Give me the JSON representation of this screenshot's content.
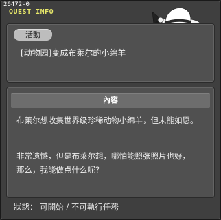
{
  "window": {
    "quest_id": "26472-0",
    "title": "QUEST INFO"
  },
  "quest": {
    "tag": "活動",
    "name": "[动物园]变成布莱尔的小绵羊"
  },
  "content": {
    "header": "內容",
    "line1": "布莱尔想收集世界级珍稀动物小绵羊，但未能如愿。",
    "line2": "非常遗憾，但是布莱尔想，哪怕能照张照片也好，",
    "line3": "那么，我能做点什么呢?"
  },
  "status": {
    "text": "狀態： 可開始 / 不可執行任務"
  },
  "colors": {
    "title": "#e8e86a",
    "window_bg": "#3f3f3f",
    "panel_bg": "#505050"
  }
}
